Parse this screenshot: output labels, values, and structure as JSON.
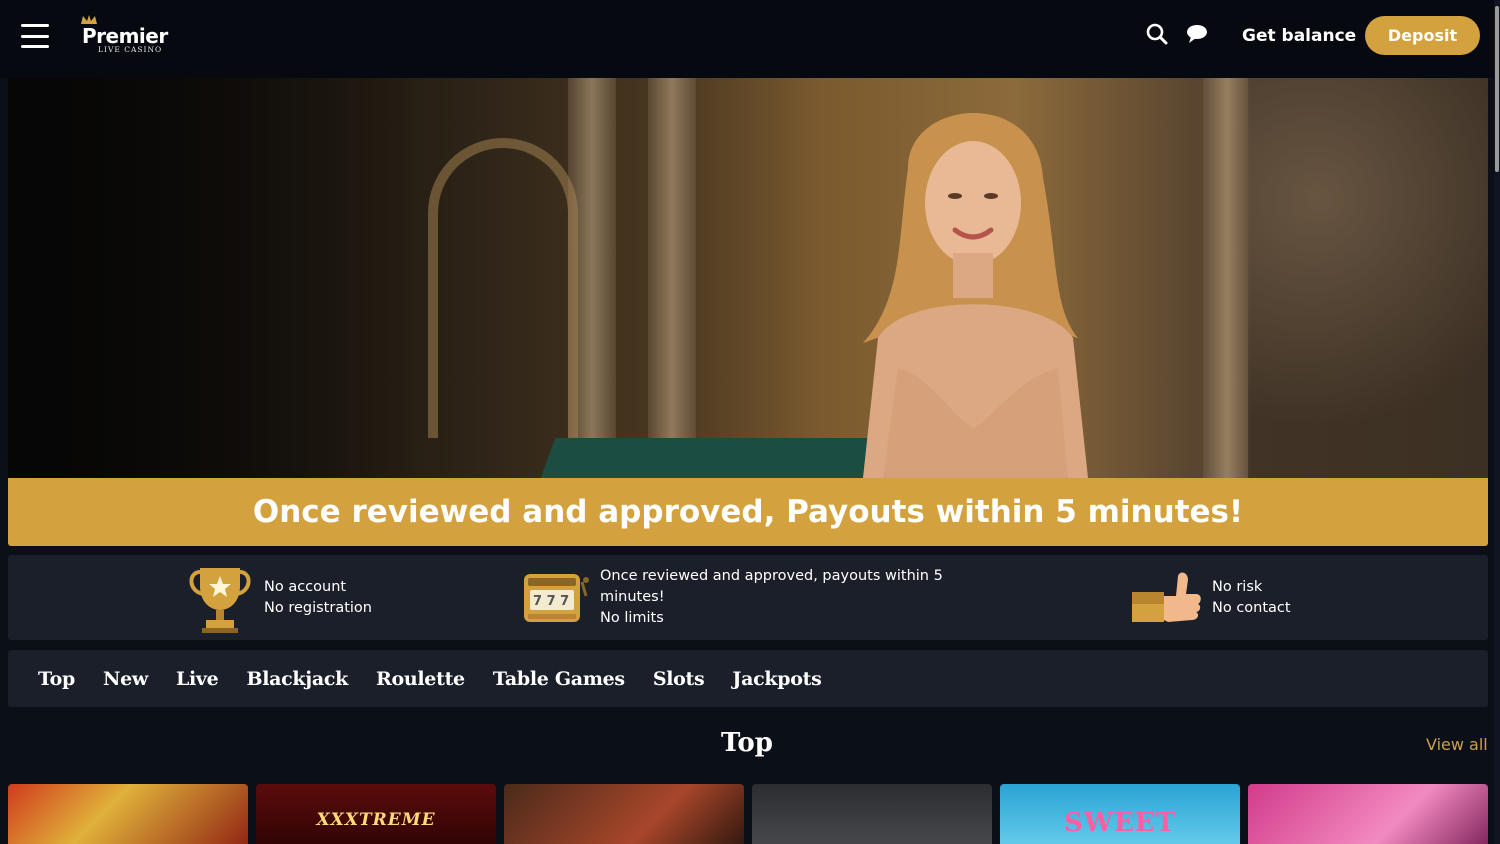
{
  "header": {
    "logo": {
      "word": "Premier",
      "sub": "LIVE CASINO"
    },
    "get_balance_label": "Get balance",
    "deposit_label": "Deposit",
    "icons": [
      "menu-icon",
      "search-icon",
      "chat-icon"
    ]
  },
  "promo": {
    "text": "Once reviewed and approved, Payouts within 5 minutes!"
  },
  "features": [
    {
      "icon": "trophy-icon",
      "lines": [
        "No account",
        "No registration"
      ]
    },
    {
      "icon": "slot-machine-icon",
      "lines": [
        "Once reviewed and approved, payouts within 5",
        "minutes!",
        "No limits"
      ]
    },
    {
      "icon": "thumbs-up-icon",
      "lines": [
        "No risk",
        "No contact"
      ]
    }
  ],
  "categories": [
    "Top",
    "New",
    "Live",
    "Blackjack",
    "Roulette",
    "Table Games",
    "Slots",
    "Jackpots"
  ],
  "section": {
    "title": "Top",
    "view_all": "View all"
  },
  "tiles": [
    {
      "label": ""
    },
    {
      "label": "XXXTREME"
    },
    {
      "label": ""
    },
    {
      "label": ""
    },
    {
      "label": "SWEET"
    },
    {
      "label": ""
    }
  ],
  "colors": {
    "accent": "#d4a13f",
    "background": "#0b0f17",
    "panel": "#1a1f29",
    "view_all": "#c8a24c"
  }
}
